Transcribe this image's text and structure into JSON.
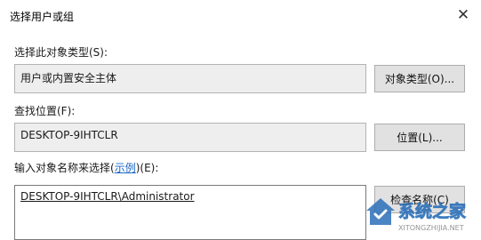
{
  "window": {
    "title": "选择用户或组",
    "close_glyph": "✕"
  },
  "object_type": {
    "label": "选择此对象类型(S):",
    "value": "用户或内置安全主体",
    "button": "对象类型(O)..."
  },
  "location": {
    "label": "查找位置(F):",
    "value": "DESKTOP-9IHTCLR",
    "button": "位置(L)..."
  },
  "object_names": {
    "label_prefix": "输入对象名称来选择(",
    "label_link": "示例",
    "label_suffix": ")(E):",
    "value": "DESKTOP-9IHTCLR\\Administrator",
    "button": "检查名称(C)"
  },
  "watermark": {
    "text": "系统之家",
    "subtext": "XITONGZHIJIA.NET"
  }
}
